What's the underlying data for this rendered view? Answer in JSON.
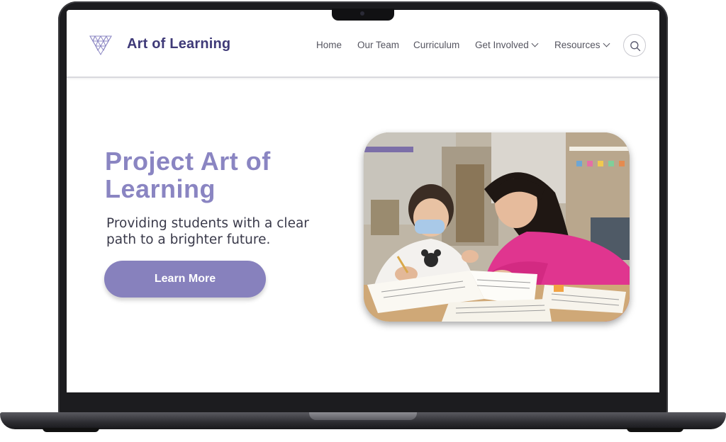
{
  "site": {
    "brand_name": "Art of Learning",
    "logo_icon": "geodesic-shield-icon",
    "brand_color": "#3f3a78",
    "accent_color": "#8781bd"
  },
  "nav": {
    "items": [
      {
        "label": "Home"
      },
      {
        "label": "Our Team"
      },
      {
        "label": "Curriculum"
      },
      {
        "label": "Get Involved",
        "has_dropdown": true
      },
      {
        "label": "Resources",
        "has_dropdown": true
      }
    ],
    "search_icon": "search-icon"
  },
  "hero": {
    "title": "Project Art of Learning",
    "subtitle": "Providing students with a clear path to a brighter future.",
    "cta_label": "Learn More",
    "title_color": "#8a85c2"
  }
}
